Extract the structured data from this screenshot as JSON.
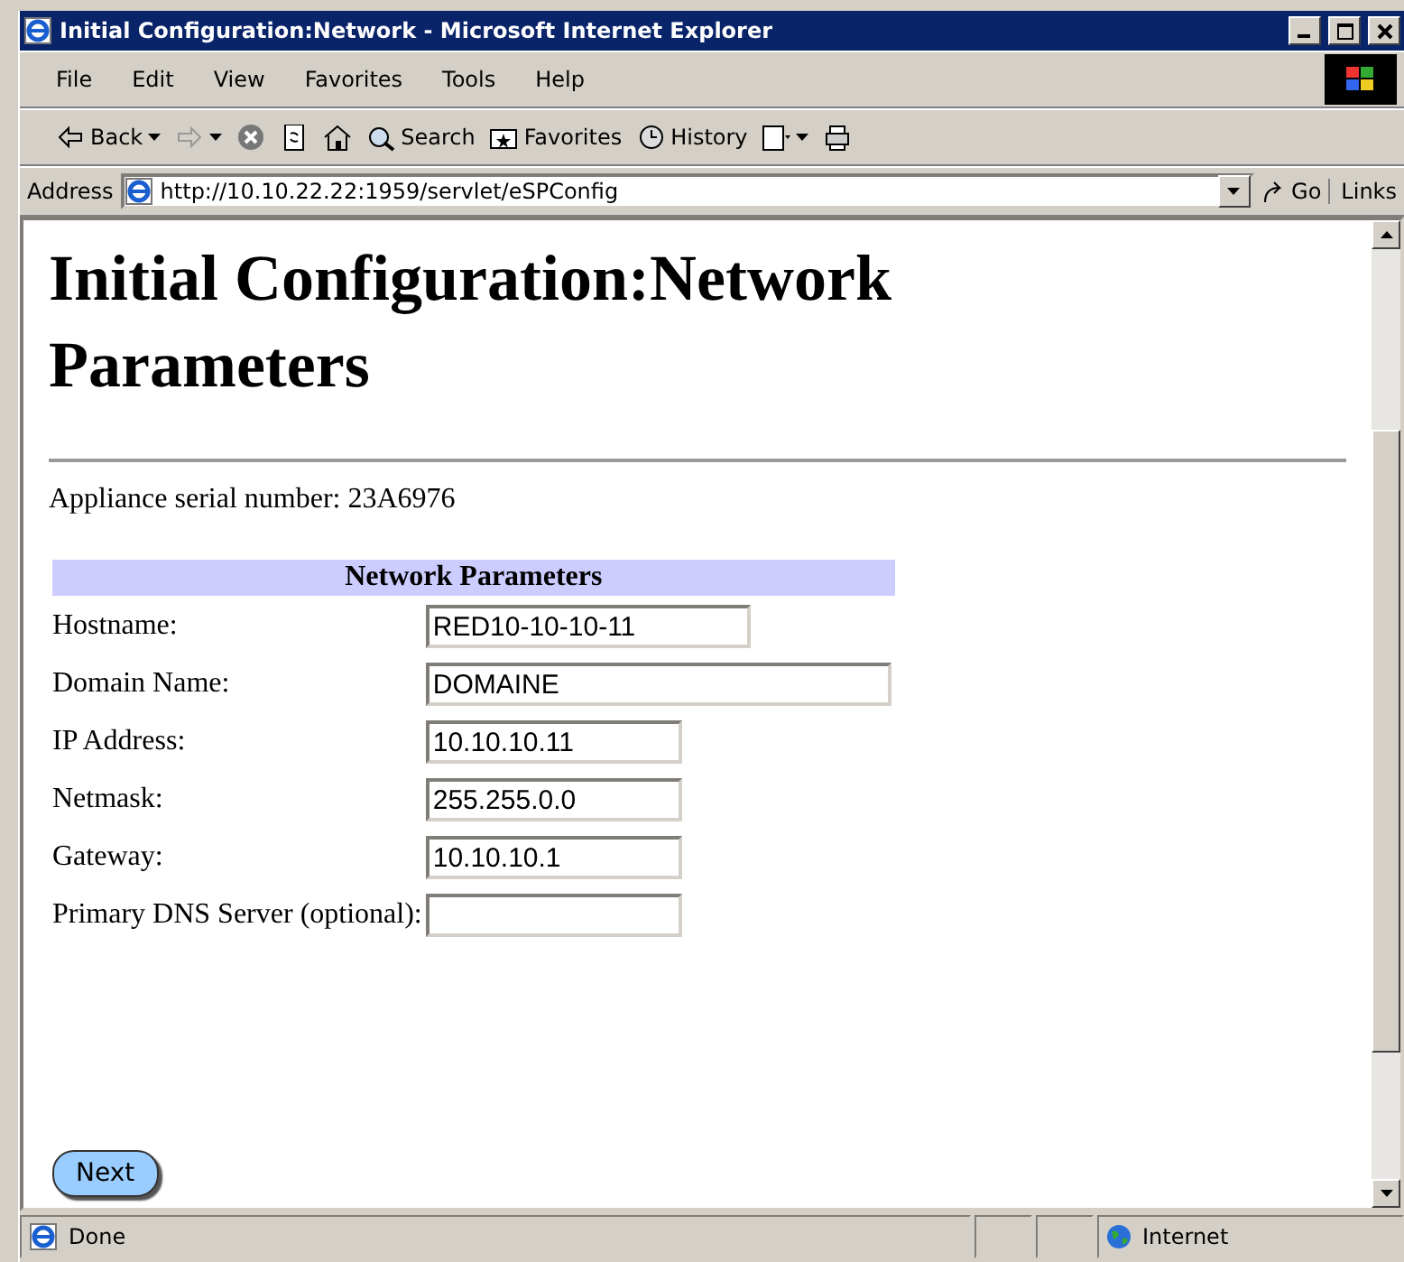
{
  "window": {
    "title": "Initial Configuration:Network - Microsoft Internet Explorer"
  },
  "menu": [
    "File",
    "Edit",
    "View",
    "Favorites",
    "Tools",
    "Help"
  ],
  "toolbar": [
    {
      "kind": "back",
      "label": "Back"
    },
    {
      "kind": "forward"
    },
    {
      "kind": "stop"
    },
    {
      "kind": "refresh"
    },
    {
      "kind": "home"
    },
    {
      "kind": "search",
      "label": "Search"
    },
    {
      "kind": "favorites",
      "label": "Favorites"
    },
    {
      "kind": "history",
      "label": "History"
    },
    {
      "kind": "mail"
    },
    {
      "kind": "print"
    }
  ],
  "address_bar": {
    "label": "Address",
    "url": "http://10.10.22.22:1959/servlet/eSPConfig",
    "go": "Go",
    "links": "Links"
  },
  "page": {
    "heading": "Initial Configuration:Network Parameters",
    "serial": "Appliance serial number: 23A6976",
    "table": {
      "header": "Network Parameters",
      "rows": [
        {
          "label": "Hostname:",
          "value": "RED10-10-10-11"
        },
        {
          "label": "Domain Name:",
          "value": "DOMAINE"
        },
        {
          "label": "IP Address:",
          "value": "10.10.10.11"
        },
        {
          "label": "Netmask:",
          "value": "255.255.0.0"
        },
        {
          "label": "Gateway:",
          "value": "10.10.10.1"
        },
        {
          "label": "Primary DNS Server (optional):",
          "value": ""
        }
      ]
    },
    "next_button": "Next"
  },
  "status_bar": {
    "text": "Done",
    "zone": "Internet"
  }
}
